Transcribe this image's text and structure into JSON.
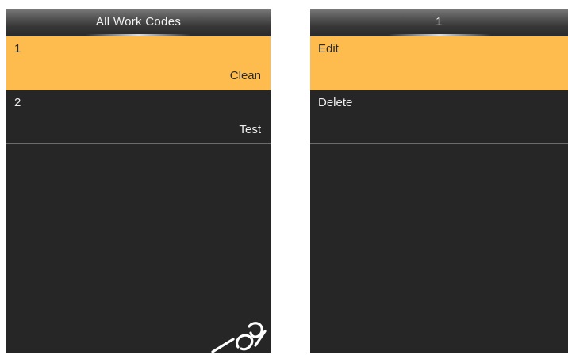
{
  "left_screen": {
    "title": "All Work Codes",
    "items": [
      {
        "number": "1",
        "name": "Clean"
      },
      {
        "number": "2",
        "name": "Test"
      }
    ]
  },
  "right_screen": {
    "title": "1",
    "menu": [
      {
        "label": "Edit"
      },
      {
        "label": "Delete"
      }
    ]
  },
  "colors": {
    "background": "#262626",
    "selected": "#fdbc4d",
    "text": "#eeeeee"
  }
}
